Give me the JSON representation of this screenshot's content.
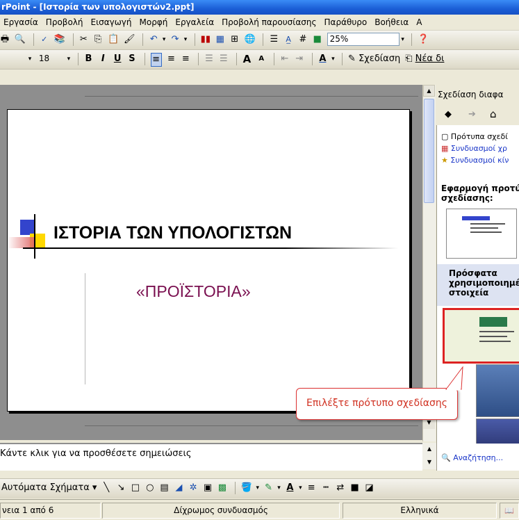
{
  "window": {
    "title": "rPoint - [Ιστορία των υπολογιστών2.ppt]"
  },
  "menu": [
    "Εργασία",
    "Προβολή",
    "Εισαγωγή",
    "Μορφή",
    "Εργαλεία",
    "Προβολή παρουσίασης",
    "Παράθυρο",
    "Βοήθεια",
    "Α"
  ],
  "standard_toolbar": {
    "zoom": "25%"
  },
  "format_toolbar": {
    "font_size": "18",
    "design_label": "Σχεδίαση",
    "new_slide_label": "Νέα δι"
  },
  "slide": {
    "title": "ΙΣΤΟΡΙΑ ΤΩΝ ΥΠΟΛΟΓΙΣΤΩΝ",
    "subtitle": "«ΠΡΟΪΣΤΟΡΙΑ»",
    "subtitle_color": "#7a1050"
  },
  "notes": {
    "placeholder": "Κάντε κλικ για να προσθέσετε σημειώσεις"
  },
  "task_pane": {
    "title": "Σχεδίαση διαφα",
    "links": [
      "Πρότυπα σχεδί",
      "Συνδυασμοί χρ",
      "Συνδυασμοί κίν"
    ],
    "apply_heading": "Εφαρμογή προτύ σχεδίασης:",
    "recent_heading": "Πρόσφατα χρησιμοποιημέ στοιχεία",
    "search_label": "Αναζήτηση..."
  },
  "callout": {
    "text": "Επιλέξτε πρότυπο σχεδίασης"
  },
  "drawing_toolbar": {
    "autoshapes_label": "Αυτόματα Σχήματα"
  },
  "status": {
    "slide_pos": "νεια 1 από 6",
    "design": "Δίχρωμος συνδυασμός",
    "language": "Ελληνικά"
  }
}
